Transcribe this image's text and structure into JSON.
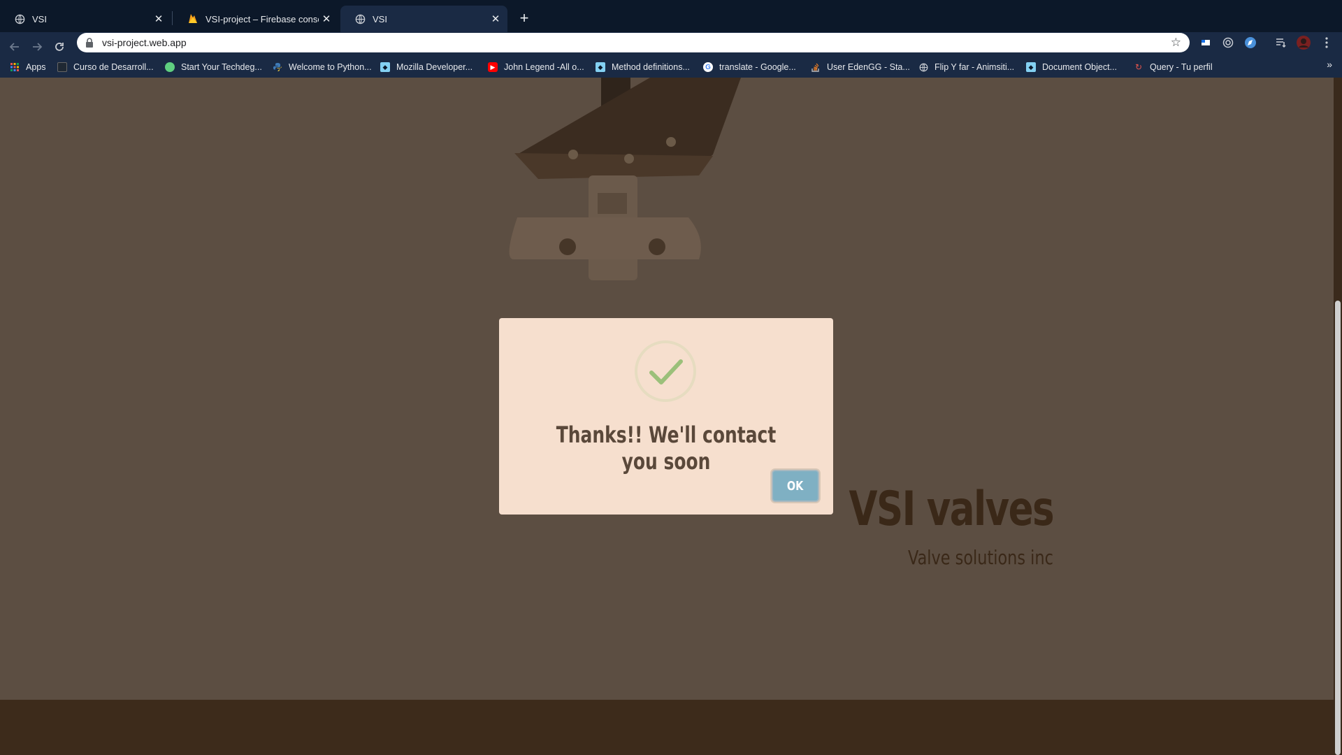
{
  "browser": {
    "tabs": [
      {
        "title": "VSI",
        "icon": "globe-icon",
        "active": false
      },
      {
        "title": "VSI-project – Firebase console",
        "icon": "firebase-icon",
        "active": false
      },
      {
        "title": "VSI",
        "icon": "globe-icon",
        "active": true
      }
    ],
    "new_tab_glyph": "+",
    "close_glyph": "✕",
    "url": "vsi-project.web.app",
    "bookmarks": [
      {
        "label": "Apps",
        "icon": "apps-grid-icon"
      },
      {
        "label": "Curso de Desarroll...",
        "icon": "bookmark-icon"
      },
      {
        "label": "Start Your Techdeg...",
        "icon": "treehouse-icon"
      },
      {
        "label": "Welcome to Python...",
        "icon": "python-icon"
      },
      {
        "label": "Mozilla Developer...",
        "icon": "mdn-icon"
      },
      {
        "label": "John Legend -All o...",
        "icon": "youtube-icon"
      },
      {
        "label": "Method definitions...",
        "icon": "mdn-icon"
      },
      {
        "label": "translate - Google...",
        "icon": "google-icon"
      },
      {
        "label": "User EdenGG - Sta...",
        "icon": "stackoverflow-icon"
      },
      {
        "label": "Flip Y far - Animsiti...",
        "icon": "globe-icon"
      },
      {
        "label": "Document Object...",
        "icon": "mdn-icon"
      },
      {
        "label": "Query - Tu perfil",
        "icon": "query-icon"
      }
    ],
    "more_bookmarks_glyph": "»"
  },
  "page": {
    "hero_title": "VSI valves",
    "hero_subtitle": "Valve solutions inc"
  },
  "modal": {
    "message": "Thanks!! We'll contact you soon",
    "ok_label": "OK"
  },
  "colors": {
    "page_overlay": "#5c4e42",
    "modal_bg": "#f6dfce",
    "ok_button": "#7fb0c3",
    "check": "#9bc07a"
  }
}
